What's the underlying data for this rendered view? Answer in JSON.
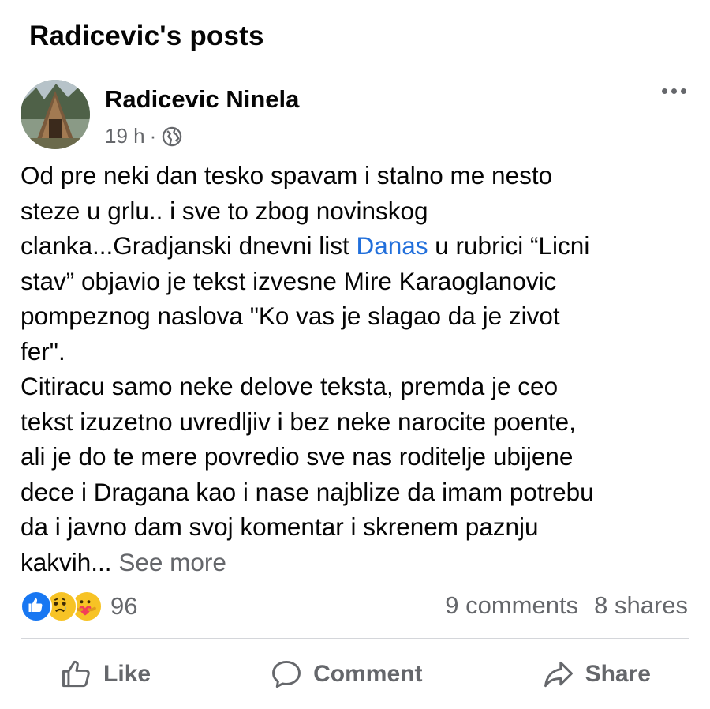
{
  "header": {
    "title": "Radicevic's posts"
  },
  "post": {
    "author": "Radicevic Ninela",
    "time": "19 h",
    "meta_separator": "·",
    "privacy_icon": "globe-icon",
    "more_icon": "more-horizontal-icon",
    "body": {
      "line1": "Od pre neki dan tesko spavam i stalno me nesto",
      "line2": "steze u grlu.. i sve to zbog novinskog",
      "line3_before": "clanka...Gradjanski dnevni list ",
      "link": "Danas",
      "line3_after": " u rubrici “Licni",
      "line4": "stav” objavio je tekst izvesne Mire Karaoglanovic",
      "line5": "pompeznog naslova \"Ko vas je slagao da je zivot",
      "line6": "fer\".",
      "line7": "Citiracu samo neke delove teksta, premda je ceo",
      "line8": "tekst izuzetno uvredljiv i bez neke narocite poente,",
      "line9": "ali je do te mere povredio sve nas roditelje ubijene",
      "line10": "dece i Dragana kao i nase najblize da imam potrebu",
      "line11": "da i javno dam svoj komentar i skrenem paznju",
      "line12": "kakvih...",
      "see_more": "See more"
    },
    "reactions": {
      "icons": [
        "like-icon",
        "sad-icon",
        "care-icon"
      ],
      "count": "96"
    },
    "stats": {
      "comments": "9 comments",
      "shares": "8 shares"
    },
    "actions": {
      "like": "Like",
      "comment": "Comment",
      "share": "Share"
    },
    "colors": {
      "link": "#216fdb",
      "muted": "#65676b",
      "like_blue": "#1877f2",
      "emoji_yellow": "#f7c325"
    }
  }
}
